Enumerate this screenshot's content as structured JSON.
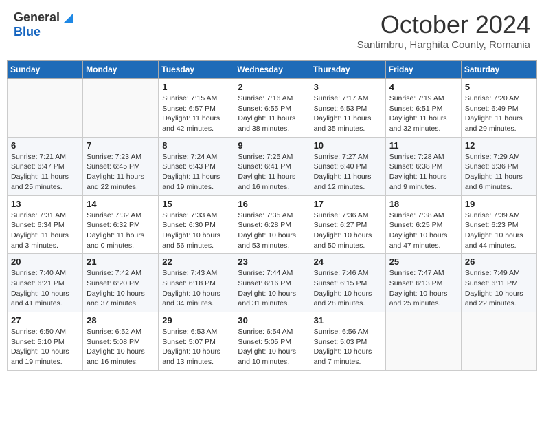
{
  "header": {
    "logo_general": "General",
    "logo_blue": "Blue",
    "month_title": "October 2024",
    "subtitle": "Santimbru, Harghita County, Romania"
  },
  "days_of_week": [
    "Sunday",
    "Monday",
    "Tuesday",
    "Wednesday",
    "Thursday",
    "Friday",
    "Saturday"
  ],
  "weeks": [
    [
      {
        "day": "",
        "info": ""
      },
      {
        "day": "",
        "info": ""
      },
      {
        "day": "1",
        "info": "Sunrise: 7:15 AM\nSunset: 6:57 PM\nDaylight: 11 hours and 42 minutes."
      },
      {
        "day": "2",
        "info": "Sunrise: 7:16 AM\nSunset: 6:55 PM\nDaylight: 11 hours and 38 minutes."
      },
      {
        "day": "3",
        "info": "Sunrise: 7:17 AM\nSunset: 6:53 PM\nDaylight: 11 hours and 35 minutes."
      },
      {
        "day": "4",
        "info": "Sunrise: 7:19 AM\nSunset: 6:51 PM\nDaylight: 11 hours and 32 minutes."
      },
      {
        "day": "5",
        "info": "Sunrise: 7:20 AM\nSunset: 6:49 PM\nDaylight: 11 hours and 29 minutes."
      }
    ],
    [
      {
        "day": "6",
        "info": "Sunrise: 7:21 AM\nSunset: 6:47 PM\nDaylight: 11 hours and 25 minutes."
      },
      {
        "day": "7",
        "info": "Sunrise: 7:23 AM\nSunset: 6:45 PM\nDaylight: 11 hours and 22 minutes."
      },
      {
        "day": "8",
        "info": "Sunrise: 7:24 AM\nSunset: 6:43 PM\nDaylight: 11 hours and 19 minutes."
      },
      {
        "day": "9",
        "info": "Sunrise: 7:25 AM\nSunset: 6:41 PM\nDaylight: 11 hours and 16 minutes."
      },
      {
        "day": "10",
        "info": "Sunrise: 7:27 AM\nSunset: 6:40 PM\nDaylight: 11 hours and 12 minutes."
      },
      {
        "day": "11",
        "info": "Sunrise: 7:28 AM\nSunset: 6:38 PM\nDaylight: 11 hours and 9 minutes."
      },
      {
        "day": "12",
        "info": "Sunrise: 7:29 AM\nSunset: 6:36 PM\nDaylight: 11 hours and 6 minutes."
      }
    ],
    [
      {
        "day": "13",
        "info": "Sunrise: 7:31 AM\nSunset: 6:34 PM\nDaylight: 11 hours and 3 minutes."
      },
      {
        "day": "14",
        "info": "Sunrise: 7:32 AM\nSunset: 6:32 PM\nDaylight: 11 hours and 0 minutes."
      },
      {
        "day": "15",
        "info": "Sunrise: 7:33 AM\nSunset: 6:30 PM\nDaylight: 10 hours and 56 minutes."
      },
      {
        "day": "16",
        "info": "Sunrise: 7:35 AM\nSunset: 6:28 PM\nDaylight: 10 hours and 53 minutes."
      },
      {
        "day": "17",
        "info": "Sunrise: 7:36 AM\nSunset: 6:27 PM\nDaylight: 10 hours and 50 minutes."
      },
      {
        "day": "18",
        "info": "Sunrise: 7:38 AM\nSunset: 6:25 PM\nDaylight: 10 hours and 47 minutes."
      },
      {
        "day": "19",
        "info": "Sunrise: 7:39 AM\nSunset: 6:23 PM\nDaylight: 10 hours and 44 minutes."
      }
    ],
    [
      {
        "day": "20",
        "info": "Sunrise: 7:40 AM\nSunset: 6:21 PM\nDaylight: 10 hours and 41 minutes."
      },
      {
        "day": "21",
        "info": "Sunrise: 7:42 AM\nSunset: 6:20 PM\nDaylight: 10 hours and 37 minutes."
      },
      {
        "day": "22",
        "info": "Sunrise: 7:43 AM\nSunset: 6:18 PM\nDaylight: 10 hours and 34 minutes."
      },
      {
        "day": "23",
        "info": "Sunrise: 7:44 AM\nSunset: 6:16 PM\nDaylight: 10 hours and 31 minutes."
      },
      {
        "day": "24",
        "info": "Sunrise: 7:46 AM\nSunset: 6:15 PM\nDaylight: 10 hours and 28 minutes."
      },
      {
        "day": "25",
        "info": "Sunrise: 7:47 AM\nSunset: 6:13 PM\nDaylight: 10 hours and 25 minutes."
      },
      {
        "day": "26",
        "info": "Sunrise: 7:49 AM\nSunset: 6:11 PM\nDaylight: 10 hours and 22 minutes."
      }
    ],
    [
      {
        "day": "27",
        "info": "Sunrise: 6:50 AM\nSunset: 5:10 PM\nDaylight: 10 hours and 19 minutes."
      },
      {
        "day": "28",
        "info": "Sunrise: 6:52 AM\nSunset: 5:08 PM\nDaylight: 10 hours and 16 minutes."
      },
      {
        "day": "29",
        "info": "Sunrise: 6:53 AM\nSunset: 5:07 PM\nDaylight: 10 hours and 13 minutes."
      },
      {
        "day": "30",
        "info": "Sunrise: 6:54 AM\nSunset: 5:05 PM\nDaylight: 10 hours and 10 minutes."
      },
      {
        "day": "31",
        "info": "Sunrise: 6:56 AM\nSunset: 5:03 PM\nDaylight: 10 hours and 7 minutes."
      },
      {
        "day": "",
        "info": ""
      },
      {
        "day": "",
        "info": ""
      }
    ]
  ]
}
